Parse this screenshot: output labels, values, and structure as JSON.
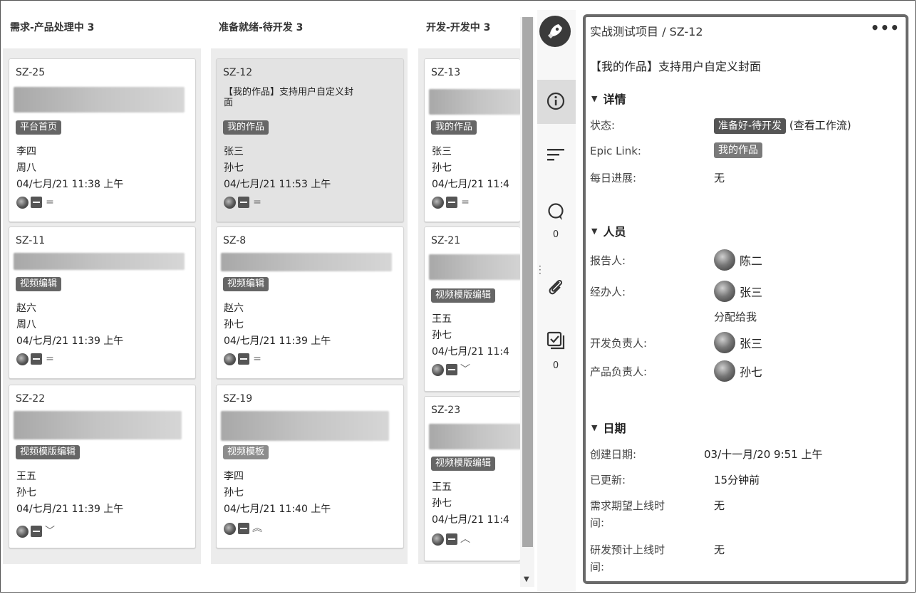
{
  "board": {
    "columns": [
      {
        "title": "需求-产品处理中 3"
      },
      {
        "title": "准备就绪-待开发 3"
      },
      {
        "title": "开发-开发中 3"
      }
    ],
    "cards": [
      {
        "key": "SZ-25",
        "tag": "平台首页",
        "line1": "李四",
        "line2": "周八",
        "date": "04/七月/21 11:38 上午",
        "priority": "="
      },
      {
        "key": "SZ-11",
        "tag": "视频编辑",
        "line1": "赵六",
        "line2": "周八",
        "date": "04/七月/21 11:39 上午",
        "priority": "="
      },
      {
        "key": "SZ-22",
        "tag": "视频模版编辑",
        "line1": "王五",
        "line2": "孙七",
        "date": "04/七月/21 11:39 上午",
        "priority": "﹀"
      },
      {
        "key": "SZ-12",
        "summary1": "【我的作品】支持用户自定义封",
        "summary2": "面",
        "tag": "我的作品",
        "line1": "张三",
        "line2": "孙七",
        "date": "04/七月/21 11:53 上午",
        "priority": "="
      },
      {
        "key": "SZ-8",
        "tag": "视频编辑",
        "line1": "赵六",
        "line2": "孙七",
        "date": "04/七月/21 11:39 上午",
        "priority": "="
      },
      {
        "key": "SZ-19",
        "tag": "视频模板",
        "line1": "李四",
        "line2": "孙七",
        "date": "04/七月/21 11:40 上午",
        "priority": "︽"
      },
      {
        "key": "SZ-13",
        "tag": "我的作品",
        "line1": "张三",
        "line2": "孙七",
        "date": "04/七月/21 11:4",
        "priority": "="
      },
      {
        "key": "SZ-21",
        "tag": "视频模版编辑",
        "line1": "王五",
        "line2": "孙七",
        "date": "04/七月/21 11:4",
        "priority": "﹀"
      },
      {
        "key": "SZ-23",
        "tag": "视频模版编辑",
        "line1": "王五",
        "line2": "孙七",
        "date": "04/七月/21 11:4",
        "priority": "︿"
      }
    ]
  },
  "rail": {
    "logo_icon": "rocket-icon",
    "info_icon": "info-icon",
    "filter_icon": "filter-lines-icon",
    "comment_count": "0",
    "attach_icon": "paperclip-icon",
    "check_count": "0"
  },
  "detail": {
    "breadcrumb": "实战测试项目 / SZ-12",
    "more": "•••",
    "title": "【我的作品】支持用户自定义封面",
    "details_section": "详情",
    "status_label": "状态:",
    "status_value": "准备好-待开发",
    "status_link": "(查看工作流)",
    "epic_label": "Epic Link:",
    "epic_value": "我的作品",
    "progress_label": "每日进展:",
    "progress_value": "无",
    "people_section": "人员",
    "reporter_label": "报告人:",
    "reporter": "陈二",
    "assignee_label": "经办人:",
    "assignee": "张三",
    "assign_to_me": "分配给我",
    "dev_owner_label": "开发负责人:",
    "dev_owner": "张三",
    "product_owner_label": "产品负责人:",
    "product_owner": "孙七",
    "dates_section": "日期",
    "created_label": "创建日期:",
    "created": "03/十一月/20 9:51 上午",
    "updated_label": "已更新:",
    "updated": "15分钟前",
    "expected_label1": "需求期望上线时",
    "expected_label2": "间:",
    "expected": "无",
    "planned_label1": "研发预计上线时",
    "planned_label2": "间:",
    "planned": "无"
  }
}
